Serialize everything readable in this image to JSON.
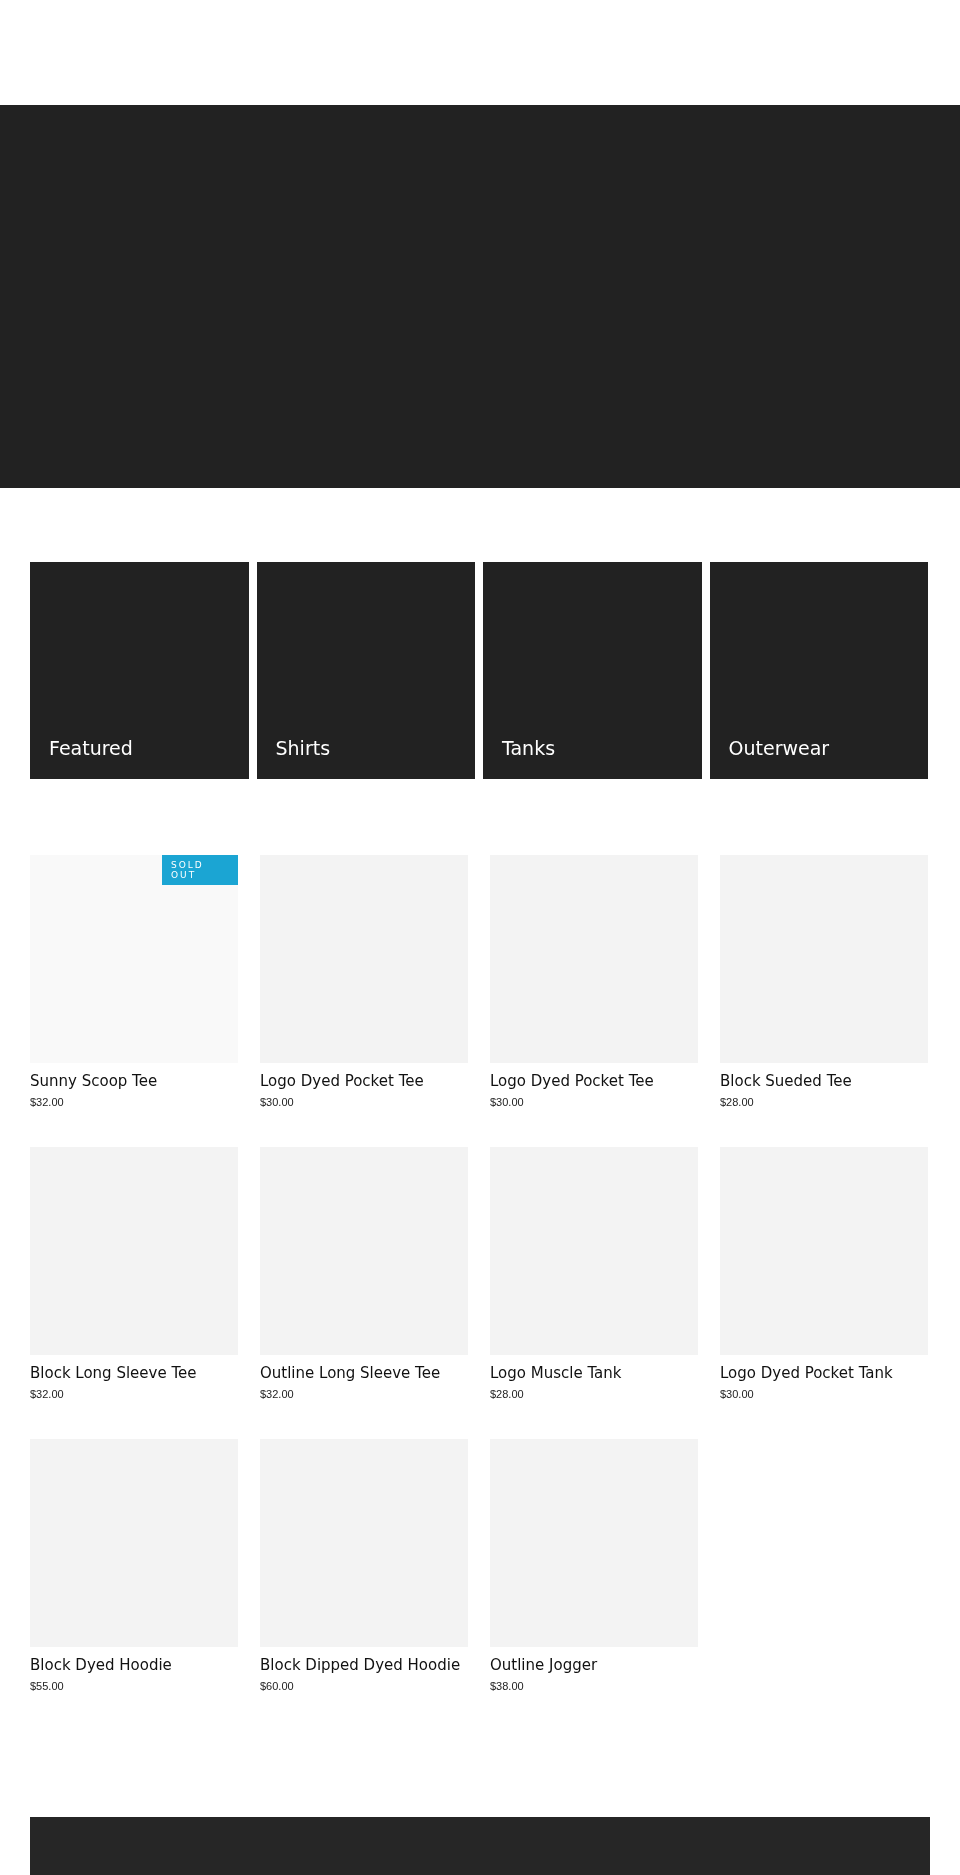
{
  "collections": [
    {
      "label": "Featured"
    },
    {
      "label": "Shirts"
    },
    {
      "label": "Tanks"
    },
    {
      "label": "Outerwear"
    }
  ],
  "sold_out_label": "SOLD OUT",
  "products": [
    {
      "title": "Sunny Scoop Tee",
      "price": "$32.00",
      "sold_out": true
    },
    {
      "title": "Logo Dyed Pocket Tee",
      "price": "$30.00",
      "sold_out": false
    },
    {
      "title": "Logo Dyed Pocket Tee",
      "price": "$30.00",
      "sold_out": false
    },
    {
      "title": "Block Sueded Tee",
      "price": "$28.00",
      "sold_out": false
    },
    {
      "title": "Block Long Sleeve Tee",
      "price": "$32.00",
      "sold_out": false
    },
    {
      "title": "Outline Long Sleeve Tee",
      "price": "$32.00",
      "sold_out": false
    },
    {
      "title": "Logo Muscle Tank",
      "price": "$28.00",
      "sold_out": false
    },
    {
      "title": "Logo Dyed Pocket Tank",
      "price": "$30.00",
      "sold_out": false
    },
    {
      "title": "Block Dyed Hoodie",
      "price": "$55.00",
      "sold_out": false
    },
    {
      "title": "Block Dipped Dyed Hoodie",
      "price": "$60.00",
      "sold_out": false
    },
    {
      "title": "Outline Jogger",
      "price": "$38.00",
      "sold_out": false
    }
  ]
}
